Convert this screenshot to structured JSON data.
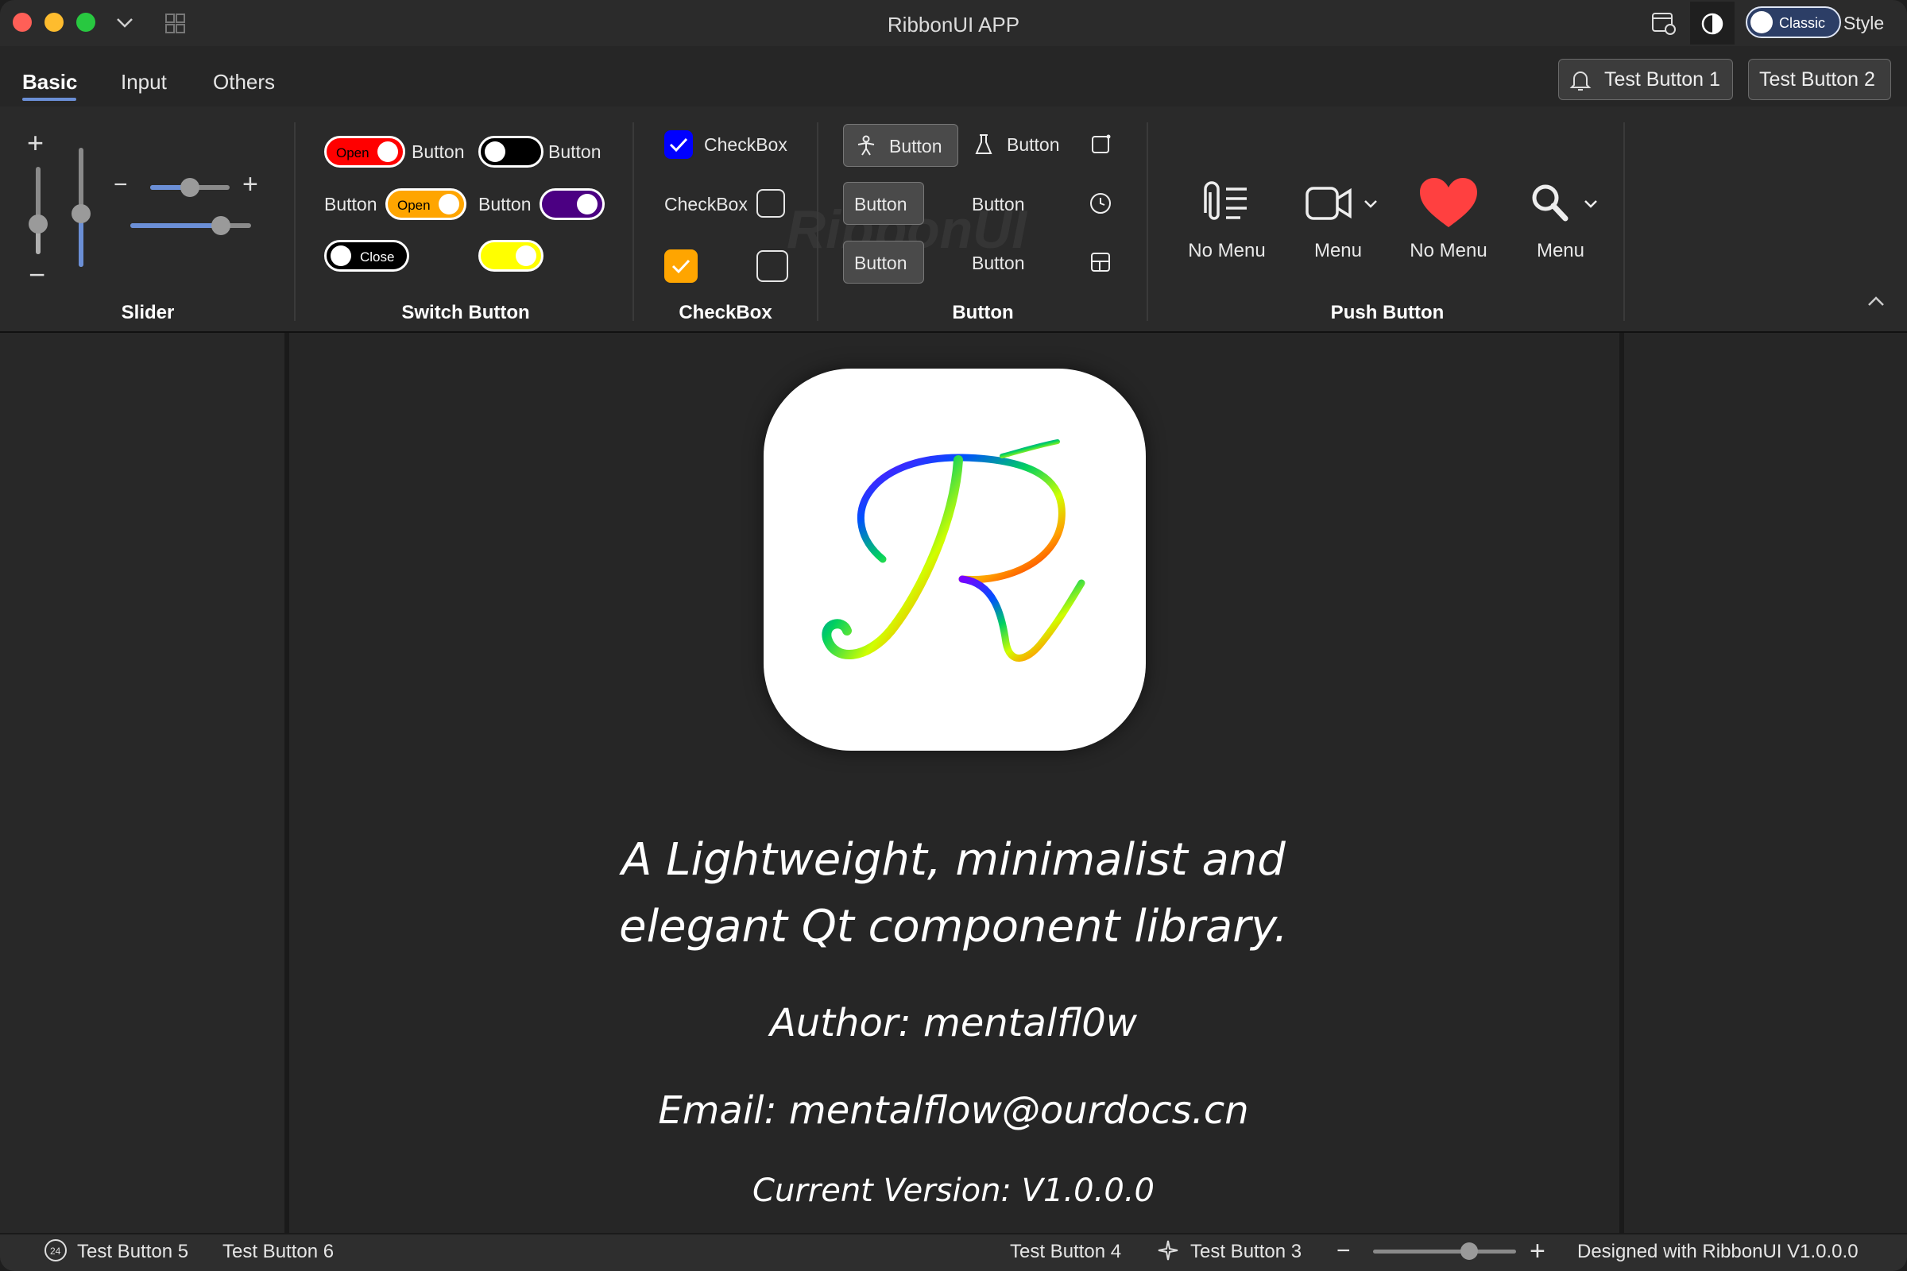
{
  "window": {
    "title": "RibbonUI APP",
    "style_toggle": "Classic",
    "style_label": "Style"
  },
  "tabs": [
    {
      "label": "Basic",
      "active": true
    },
    {
      "label": "Input",
      "active": false
    },
    {
      "label": "Others",
      "active": false
    }
  ],
  "top_buttons": {
    "b1": "Test Button 1",
    "b2": "Test Button 2"
  },
  "groups": {
    "slider": {
      "label": "Slider",
      "vertical_1": 0.35,
      "vertical_2": 0.45,
      "horizontal_1": 0.5,
      "horizontal_2": 0.75
    },
    "switch": {
      "label": "Switch Button",
      "items": [
        {
          "label": "Open",
          "color": "#ff0000",
          "on": true
        },
        {
          "text": "Button"
        },
        {
          "color": "#000000",
          "on": false
        },
        {
          "text": "Button"
        },
        {
          "text": "Button"
        },
        {
          "label": "Open",
          "color": "#ffa500",
          "on": true
        },
        {
          "text": "Button"
        },
        {
          "color": "#4b0082",
          "on": true
        },
        {
          "label": "Close",
          "color": "#000000",
          "on": false
        },
        {
          "color": "#ffff00",
          "on": true
        }
      ]
    },
    "checkbox": {
      "label": "CheckBox",
      "items": [
        {
          "text": "CheckBox",
          "checked": true,
          "color": "#0000ff"
        },
        {
          "text": "CheckBox",
          "checked": false
        },
        {
          "checked": true,
          "color": "#ffa500"
        },
        {
          "checked": false
        }
      ]
    },
    "button": {
      "label": "Button",
      "items": [
        {
          "text": "Button",
          "icon": "figure-icon",
          "boxed": true
        },
        {
          "text": "Button",
          "icon": "flask-icon",
          "boxed": false
        },
        {
          "icon": "square-icon"
        },
        {
          "text": "Button",
          "boxed": true
        },
        {
          "text": "Button",
          "boxed": false
        },
        {
          "icon": "clock-icon"
        },
        {
          "text": "Button",
          "boxed": true
        },
        {
          "text": "Button",
          "boxed": false
        },
        {
          "icon": "layout-icon"
        }
      ],
      "watermark": "RibbonUI"
    },
    "push": {
      "label": "Push Button",
      "items": [
        {
          "text": "No Menu",
          "icon": "clip-list-icon"
        },
        {
          "text": "Menu",
          "icon": "video-icon",
          "menu": true
        },
        {
          "text": "No Menu",
          "icon": "heart-icon"
        },
        {
          "text": "Menu",
          "icon": "search-icon",
          "menu": true
        }
      ]
    }
  },
  "content": {
    "line1": "A Lightweight, minimalist and",
    "line2": "elegant Qt component library.",
    "author": "Author: mentalfl0w",
    "email": "Email: mentalflow@ourdocs.cn",
    "version": "Current Version: V1.0.0.0",
    "logo_letter": "R"
  },
  "status": {
    "badge": "24",
    "left1": "Test Button 5",
    "left2": "Test Button 6",
    "right1": "Test Button 4",
    "right2": "Test Button 3",
    "zoom_value": 0.68,
    "credit": "Designed with RibbonUI V1.0.0.0"
  },
  "colors": {
    "accent": "#6b8fd6",
    "background": "#262626",
    "heart": "#ff4040"
  }
}
